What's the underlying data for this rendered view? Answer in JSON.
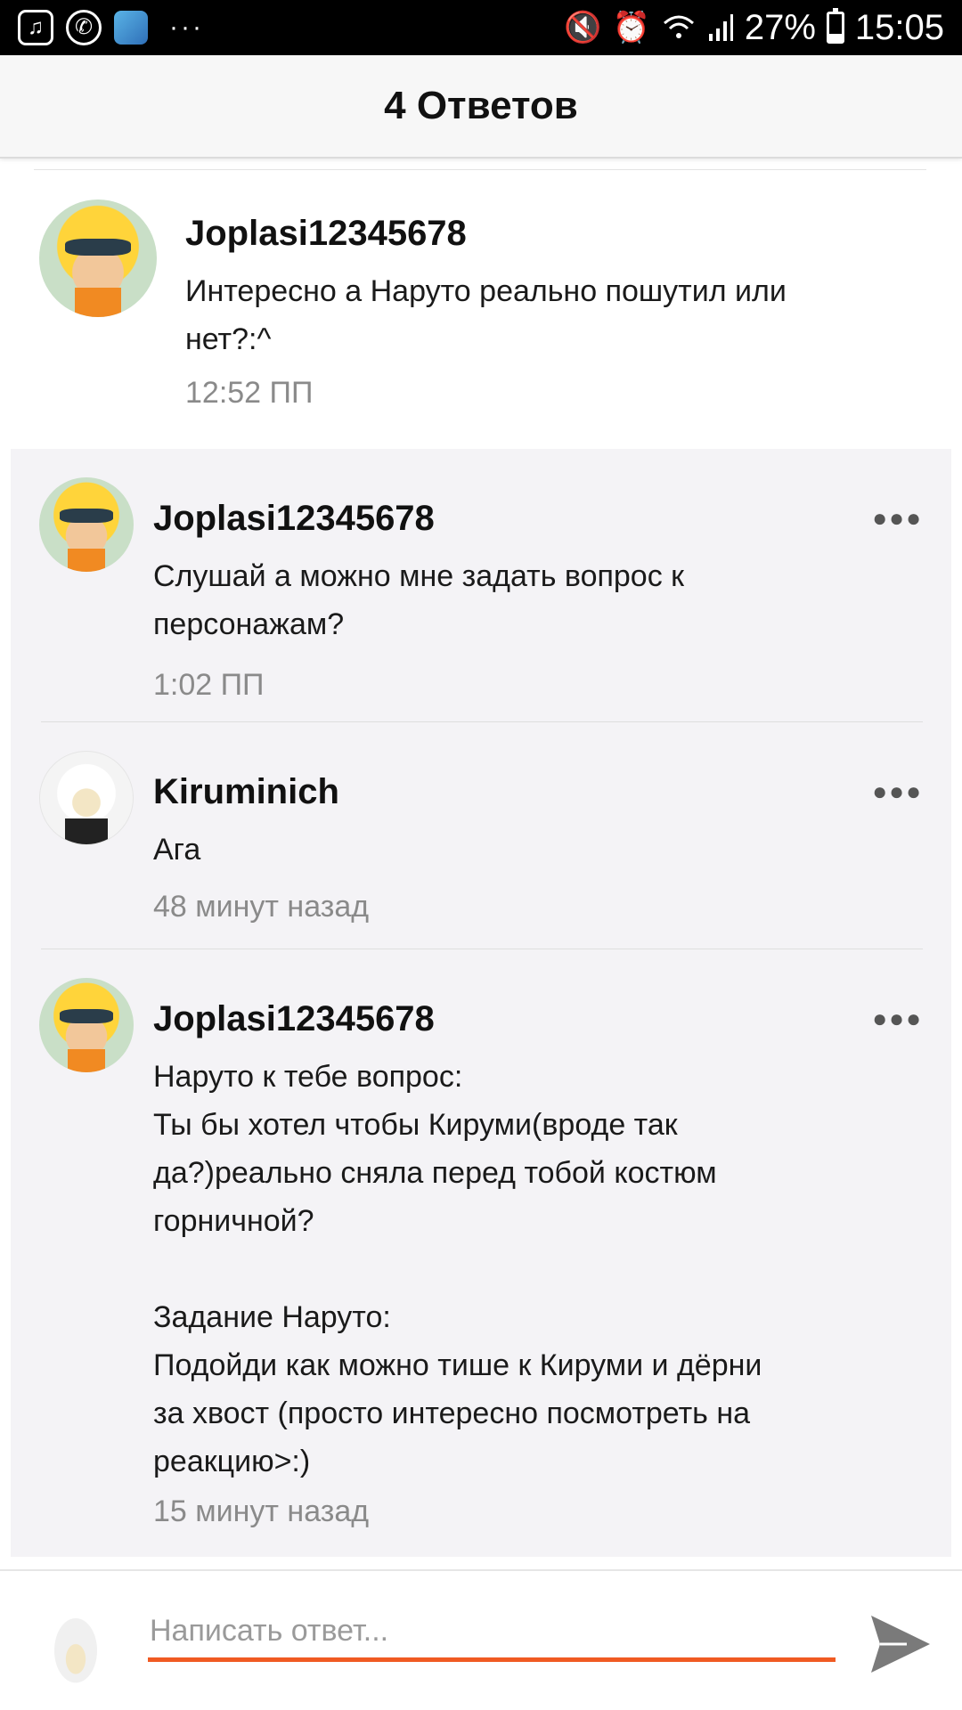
{
  "status_bar": {
    "icons_left": [
      "music-note-icon",
      "viber-icon",
      "app-icon"
    ],
    "more": "···",
    "battery_percent": "27%",
    "battery_level": 0.27,
    "time": "15:05"
  },
  "header": {
    "title": "4 Ответов"
  },
  "main_comment": {
    "username": "Joplasi12345678",
    "text": "Интересно а Наруто реально пошутил или\nнет?:^",
    "time": "12:52 ПП"
  },
  "replies": [
    {
      "username": "Joplasi12345678",
      "text": "Слушай а можно мне задать вопрос к\nперсонажам?",
      "time": "1:02 ПП",
      "more": "●●●"
    },
    {
      "username": "Kiruminich",
      "text": "Ага",
      "time": "48 минут назад",
      "more": "●●●"
    },
    {
      "username": "Joplasi12345678",
      "text": "Наруто к тебе вопрос:\nТы бы хотел чтобы Кируми(вроде так\nда?)реально сняла перед тобой костюм\nгорничной?\n\nЗадание Наруто:\nПодойди как можно тише к Кируми и дёрни\nза хвост (просто интересно посмотреть на\nреакцию>:)",
      "time": "15 минут назад",
      "more": "●●●"
    }
  ],
  "reply_input": {
    "placeholder": "Написать ответ...",
    "value": ""
  },
  "colors": {
    "accent": "#f05a22",
    "reply_bg": "#f4f3f6",
    "header_bg": "#f7f7f7"
  }
}
